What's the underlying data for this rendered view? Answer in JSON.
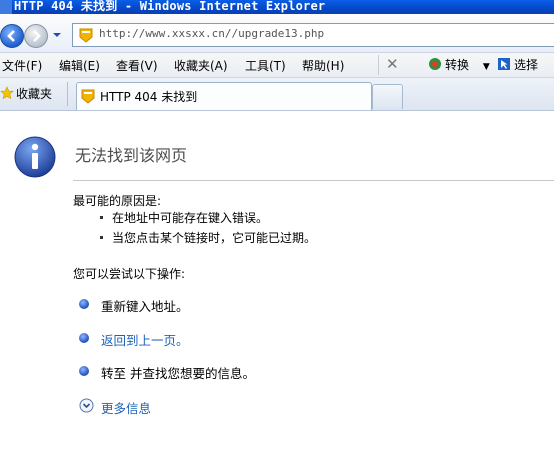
{
  "window": {
    "title": "HTTP 404 未找到 - Windows Internet Explorer"
  },
  "address_bar": {
    "url": "http://www.xxsxx.cn//upgrade13.php"
  },
  "menu": {
    "items": [
      "文件(F)",
      "编辑(E)",
      "查看(V)",
      "收藏夹(A)",
      "工具(T)",
      "帮助(H)"
    ],
    "convert_label": "转换",
    "select_label": "选择"
  },
  "tabs": {
    "favorites_label": "收藏夹",
    "active_tab_title": "HTTP 404 未找到"
  },
  "page": {
    "heading": "无法找到该网页",
    "causes_title": "最可能的原因是:",
    "causes": [
      "在地址中可能存在键入错误。",
      "当您点击某个链接时，它可能已过期。"
    ],
    "actions_title": "您可以尝试以下操作:",
    "actions": [
      "重新键入地址。",
      "返回到上一页。",
      "转至  并查找您想要的信息。"
    ],
    "more_info": "更多信息"
  }
}
